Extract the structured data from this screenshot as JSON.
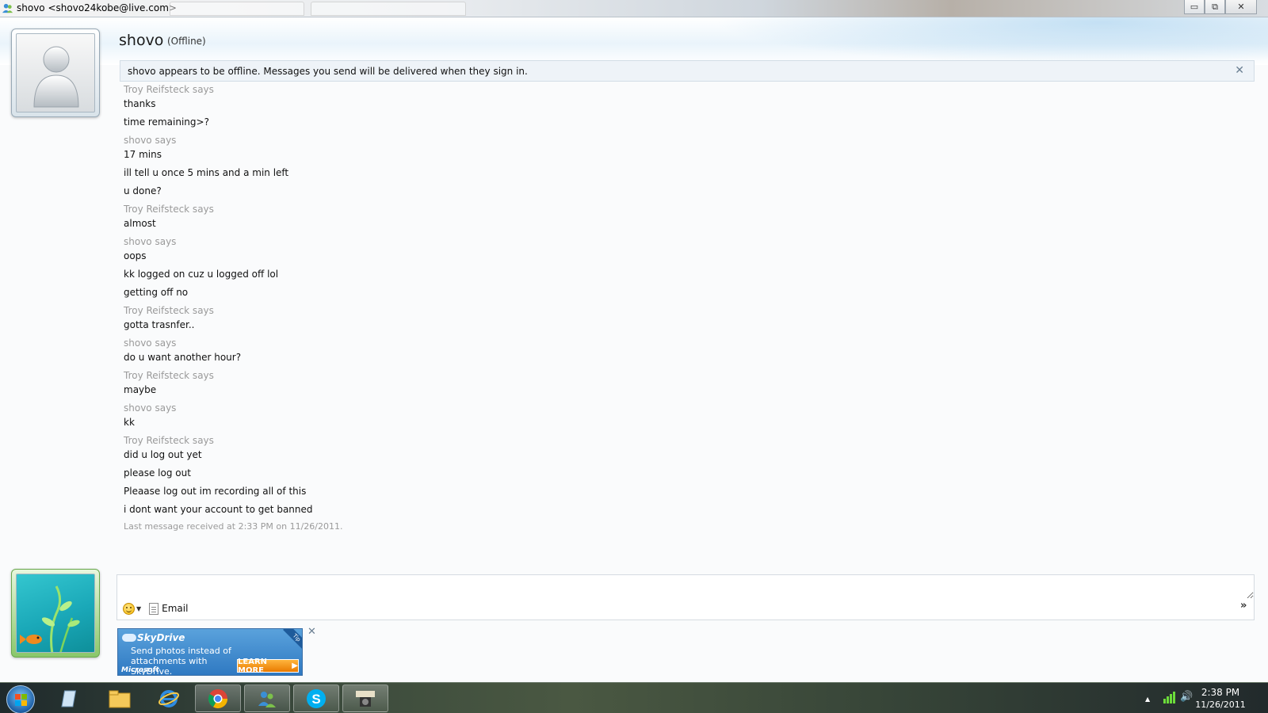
{
  "window": {
    "title": "shovo <shovo24kobe@live.com>",
    "minimize_glyph": "▭",
    "maximize_glyph": "⧉",
    "close_glyph": "✕"
  },
  "contact": {
    "name": "shovo",
    "status": "(Offline)"
  },
  "infobar": {
    "message": "shovo appears to be offline. Messages you send will be delivered when they sign in.",
    "close_glyph": "✕"
  },
  "conversation": [
    {
      "sender": "Troy Reifsteck says",
      "lines": [
        "thanks",
        "time remaining>?"
      ]
    },
    {
      "sender": "shovo says",
      "lines": [
        "17 mins",
        "ill tell u once 5 mins and a min left",
        "u done?"
      ]
    },
    {
      "sender": "Troy Reifsteck says",
      "lines": [
        "almost"
      ]
    },
    {
      "sender": "shovo says",
      "lines": [
        "oops",
        "kk logged on cuz u logged off lol",
        "getting off no"
      ]
    },
    {
      "sender": "Troy Reifsteck says",
      "lines": [
        "gotta trasnfer.."
      ]
    },
    {
      "sender": "shovo says",
      "lines": [
        "do u want another hour?"
      ]
    },
    {
      "sender": "Troy Reifsteck says",
      "lines": [
        "maybe"
      ]
    },
    {
      "sender": "shovo says",
      "lines": [
        "kk"
      ]
    },
    {
      "sender": "Troy Reifsteck says",
      "lines": [
        "did u log out yet",
        "please log out",
        "Pleaase log out im recording all of this",
        "i dont want your account to get banned"
      ]
    }
  ],
  "last_received": "Last message received at 2:33 PM on 11/26/2011.",
  "compose": {
    "value": "",
    "email_label": "Email",
    "more_glyph": "»"
  },
  "ad": {
    "brand": "SkyDrive",
    "text": "Send photos instead of attachments with SkyDrive.",
    "company": "Microsoft",
    "cta": "LEARN MORE",
    "tag": "Tip",
    "close_glyph": "✕"
  },
  "taskbar": {
    "items": [
      "start-orb",
      "notepad-icon",
      "explorer-icon",
      "internet-explorer-icon",
      "chrome-icon",
      "messenger-icon",
      "skype-icon",
      "hypercam-icon"
    ],
    "tray_arrow": "▲",
    "volume_glyph": "🔊",
    "time": "2:38 PM",
    "date": "11/26/2011"
  },
  "colors": {
    "sender_gray": "#9a9a9a",
    "infobar_bg": "#eef3f8",
    "link_blue": "#2f79c2",
    "cta_orange": "#e97a00"
  }
}
